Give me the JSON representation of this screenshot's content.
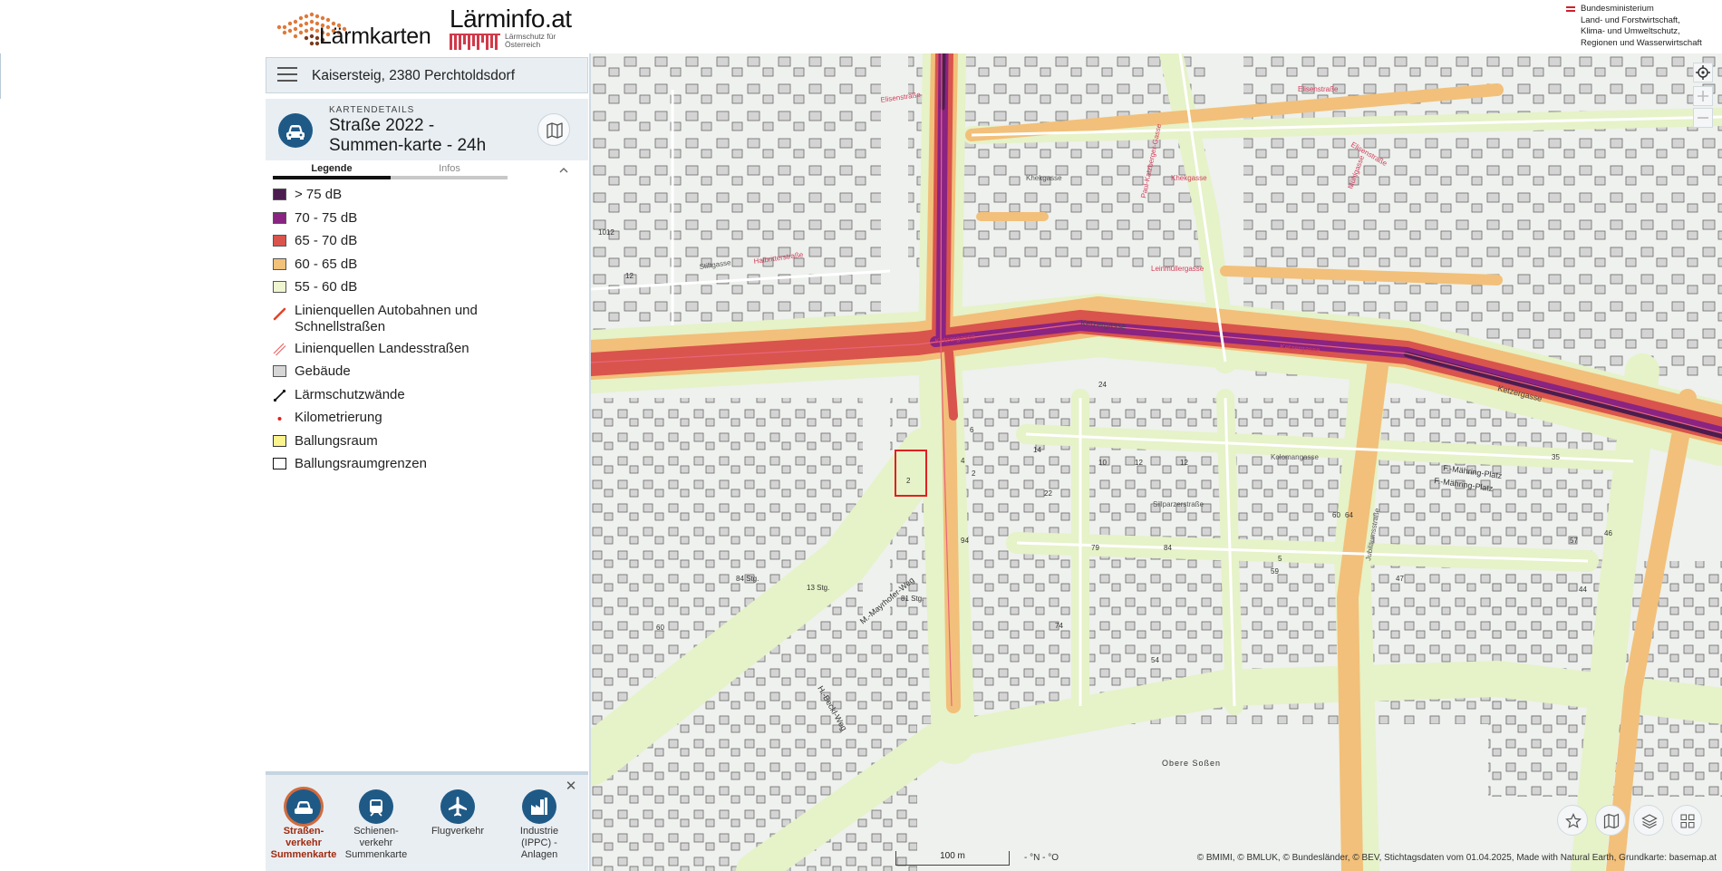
{
  "header": {
    "logo_laermkarten": "Lärmkarten",
    "logo_laerminfo": "Lärminfo.at",
    "logo_laerminfo_sub": "Lärmschutz für\nÖsterreich",
    "ministry": "Bundesministerium\nLand- und Forstwirtschaft,\nKlima- und Umweltschutz,\nRegionen und Wasserwirtschaft"
  },
  "search": {
    "value": "Kaisersteig, 2380 Perchtoldsdorf"
  },
  "map_details": {
    "kicker": "KARTENDETAILS",
    "title": "Straße 2022 - Summen-karte - 24h"
  },
  "tabs": [
    {
      "label": "Legende",
      "active": true
    },
    {
      "label": "Infos",
      "active": false
    }
  ],
  "legend": [
    {
      "label": "> 75 dB",
      "color": "#4b1d4e"
    },
    {
      "label": "70 - 75 dB",
      "color": "#8a2382"
    },
    {
      "label": "65 - 70 dB",
      "color": "#d9544c"
    },
    {
      "label": "60 - 65 dB",
      "color": "#f2c17a"
    },
    {
      "label": "55 - 60 dB",
      "color": "#eff5cf"
    },
    {
      "label": "Linienquellen Autobahnen und Schnellstraßen",
      "symbol": "line-solid-orange"
    },
    {
      "label": "Linienquellen Landesstraßen",
      "symbol": "line-double-red"
    },
    {
      "label": "Gebäude",
      "color": "#d6d6d6"
    },
    {
      "label": "Lärmschutzwände",
      "symbol": "line-black"
    },
    {
      "label": "Kilometrierung",
      "symbol": "red-dot"
    },
    {
      "label": "Ballungsraum",
      "color": "#fdf38c"
    },
    {
      "label": "Ballungsraumgrenzen",
      "color": "#ffffff"
    }
  ],
  "modes": [
    {
      "label": "Straßen-\nverkehr\nSummenkarte",
      "icon": "car-icon",
      "active": true
    },
    {
      "label": "Schienen-\nverkehr\nSummenkarte",
      "icon": "train-icon",
      "active": false
    },
    {
      "label": "Flugverkehr",
      "icon": "plane-icon",
      "active": false
    },
    {
      "label": "Industrie\n(IPPC) -\nAnlagen",
      "icon": "factory-icon",
      "active": false
    }
  ],
  "map": {
    "street_labels": [
      "Elisenstraße",
      "Elisenstraße",
      "Khekgasse",
      "Khekgasse",
      "Halbritterstraße",
      "Stiftgasse",
      "Leinmüllergasse",
      "Paul-Katzberger-Gasse",
      "Elisenstraße",
      "Mühlgasse",
      "Ketzergasse",
      "Ketzergasse",
      "Ketzergasse",
      "Ketzergasse",
      "F.-Mähring-Platz",
      "F.-Mähring-Platz",
      "Kolomangasse",
      "Jubiläumsstraße",
      "M.-Mayrhofer-Weg",
      "H.-Beckl-Weg",
      "Obere Soßen",
      "Sillparzerstraße"
    ],
    "house_numbers": [
      "6",
      "4",
      "2",
      "2",
      "74",
      "79",
      "84",
      "94",
      "54",
      "46",
      "47",
      "59",
      "60",
      "64",
      "14",
      "12",
      "22",
      "10",
      "12",
      "24",
      "60",
      "44",
      "35",
      "57",
      "1012",
      "13 Stg.",
      "84 Stg.",
      "81 Stg.",
      "12",
      "5"
    ],
    "scale_label": "100 m",
    "coordinate": "- °N - °O",
    "attribution": "© BMIMI, © BMLUK, © Bundesländer, © BEV, Stichtagsdaten vom 01.04.2025, Made with Natural Earth, Grundkarte: basemap.at"
  }
}
